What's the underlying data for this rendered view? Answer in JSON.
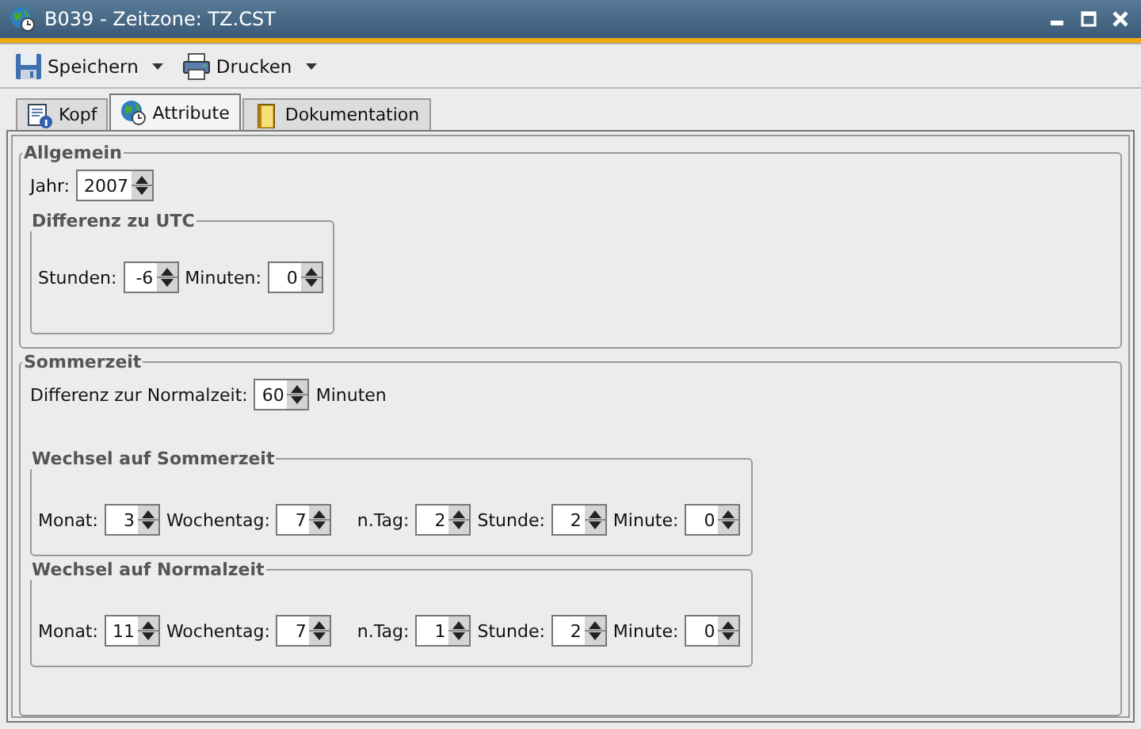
{
  "window": {
    "title": "B039 - Zeitzone: TZ.CST"
  },
  "toolbar": [
    {
      "kind": "save",
      "label": "Speichern"
    },
    {
      "kind": "print",
      "label": "Drucken"
    }
  ],
  "tabs": [
    {
      "kind": "info",
      "label": "Kopf",
      "selected": false
    },
    {
      "kind": "globe",
      "label": "Attribute",
      "selected": true
    },
    {
      "kind": "book",
      "label": "Dokumentation",
      "selected": false
    }
  ],
  "groups": [
    {
      "title": "Allgemein",
      "rows": [
        {
          "fields": [
            {
              "label": "Jahr:",
              "value": "2007"
            }
          ]
        }
      ],
      "subgroups": [
        {
          "title": "Differenz zu UTC",
          "fields": [
            {
              "label": "Stunden:",
              "value": "-6"
            },
            {
              "label": "Minuten:",
              "value": "0"
            }
          ]
        }
      ]
    },
    {
      "title": "Sommerzeit",
      "rows": [
        {
          "fields": [
            {
              "label": "Differenz zur Normalzeit:",
              "value": "60",
              "unit": "Minuten"
            }
          ]
        }
      ],
      "subgroups": [
        {
          "title": "Wechsel auf Sommerzeit",
          "fields": [
            {
              "label": "Monat:",
              "value": "3"
            },
            {
              "label": "Wochentag:",
              "value": "7"
            },
            {
              "label": "n.Tag:",
              "value": "2"
            },
            {
              "label": "Stunde:",
              "value": "2"
            },
            {
              "label": "Minute:",
              "value": "0"
            }
          ]
        },
        {
          "title": "Wechsel auf Normalzeit",
          "fields": [
            {
              "label": "Monat:",
              "value": "11"
            },
            {
              "label": "Wochentag:",
              "value": "7"
            },
            {
              "label": "n.Tag:",
              "value": "1"
            },
            {
              "label": "Stunde:",
              "value": "2"
            },
            {
              "label": "Minute:",
              "value": "0"
            }
          ]
        }
      ]
    }
  ]
}
